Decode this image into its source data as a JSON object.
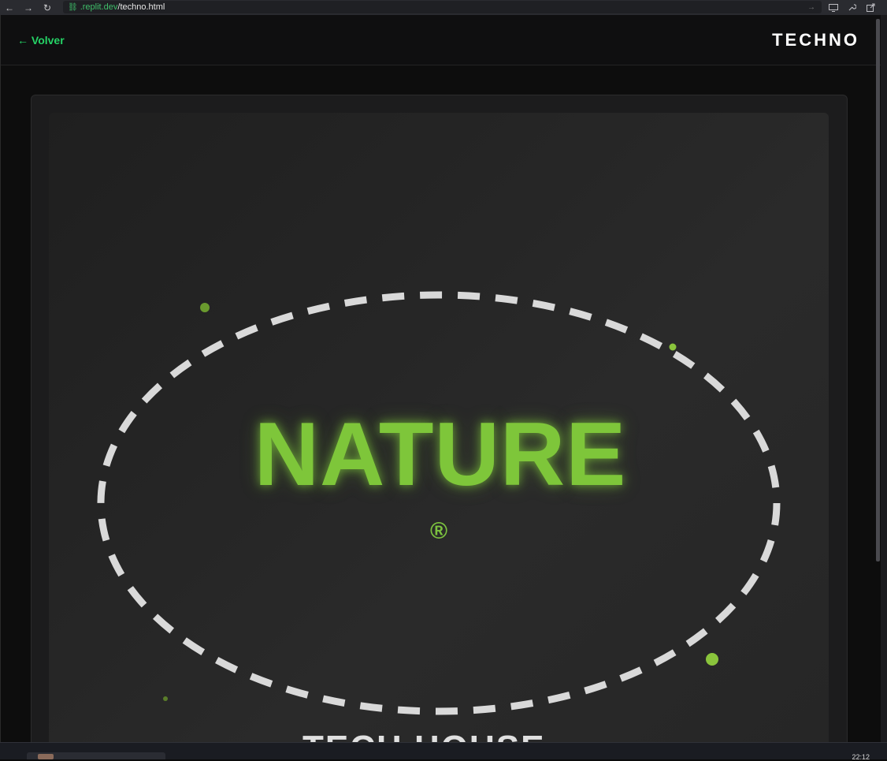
{
  "browser": {
    "back_icon": "←",
    "forward_icon": "→",
    "reload_icon": "↻",
    "url_domain": ".replit.dev",
    "url_path": "/techno.html",
    "go_icon": "→"
  },
  "nav": {
    "back_label": "← Volver",
    "brand": "TECHNO"
  },
  "hero": {
    "title": "NATURE",
    "registered_mark": "®",
    "subtitle_partial": "TECH HOUSE",
    "accent_color": "#7ec63a",
    "ellipse_color": "#d9d9d9"
  },
  "taskbar": {
    "clock": "22:12"
  }
}
